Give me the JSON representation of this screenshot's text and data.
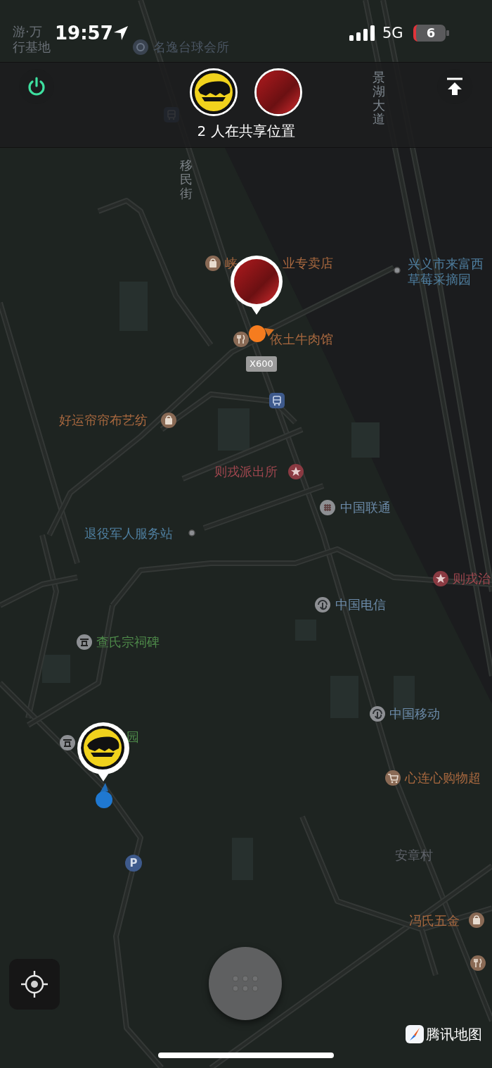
{
  "status_bar": {
    "time": "19:57",
    "network": "5G",
    "battery": "6"
  },
  "header": {
    "avatars": [
      {
        "kind": "logo"
      },
      {
        "kind": "photo"
      }
    ],
    "sharing_text": "2 人在共享位置"
  },
  "map": {
    "labels": [
      {
        "kind": "plain",
        "lines": [
          "游·万",
          "行基地"
        ],
        "color": "#6a7077"
      },
      {
        "kind": "emblem",
        "lines": [
          "名逸台球会所"
        ],
        "color": "#4a5562"
      },
      {
        "kind": "vertical",
        "lines": [
          "景湖大道"
        ],
        "color": "#7f8890"
      },
      {
        "kind": "vertical",
        "lines": [
          "移民街"
        ],
        "color": "#7d8388"
      },
      {
        "kind": "shop",
        "lines": [
          "峡"
        ],
        "color": "#a8683f"
      },
      {
        "kind": "plain",
        "lines": [
          "业专卖店"
        ],
        "color": "#a8683f"
      },
      {
        "kind": "food",
        "lines": [
          "依土牛肉馆"
        ],
        "color": "#a8683f"
      },
      {
        "kind": "dot",
        "lines": [
          "兴义市来富西",
          "草莓采摘园"
        ],
        "color": "#4f7fa0"
      },
      {
        "kind": "shop",
        "lines": [
          "好运帘帘布艺纺"
        ],
        "color": "#a8683f"
      },
      {
        "kind": "police",
        "lines": [
          "则戎派出所"
        ],
        "color": "#a0474f"
      },
      {
        "kind": "knot",
        "lines": [
          "中国联通"
        ],
        "color": "#6b8aa8"
      },
      {
        "kind": "dot",
        "lines": [
          "退役军人服务站"
        ],
        "color": "#4f7fa0"
      },
      {
        "kind": "police",
        "lines": [
          "则戎治"
        ],
        "color": "#a0474f"
      },
      {
        "kind": "swirl",
        "lines": [
          "中国电信"
        ],
        "color": "#6b8aa8"
      },
      {
        "kind": "gate",
        "lines": [
          "查氏宗祠碑"
        ],
        "color": "#4e8a4a"
      },
      {
        "kind": "gate",
        "lines": [
          "园"
        ],
        "color": "#4e8a4a"
      },
      {
        "kind": "swirl",
        "lines": [
          "中国移动"
        ],
        "color": "#6b8aa8"
      },
      {
        "kind": "cart",
        "lines": [
          "心连心购物超"
        ],
        "color": "#a8683f"
      },
      {
        "kind": "plain",
        "lines": [
          "安章村"
        ],
        "color": "#5d6168"
      },
      {
        "kind": "shop",
        "lines": [
          "冯氏五金"
        ],
        "color": "#a8683f"
      },
      {
        "kind": "food"
      },
      {
        "kind": "bus"
      },
      {
        "kind": "bus"
      },
      {
        "kind": "parking",
        "glyph": "P"
      }
    ],
    "road_badge": "X600",
    "pins": [
      {
        "kind": "photo"
      },
      {
        "kind": "logo"
      }
    ],
    "location_dots": [
      {
        "color": "#f57c1f"
      },
      {
        "color": "#1f78d1"
      }
    ]
  },
  "map_logo": "腾讯地图"
}
